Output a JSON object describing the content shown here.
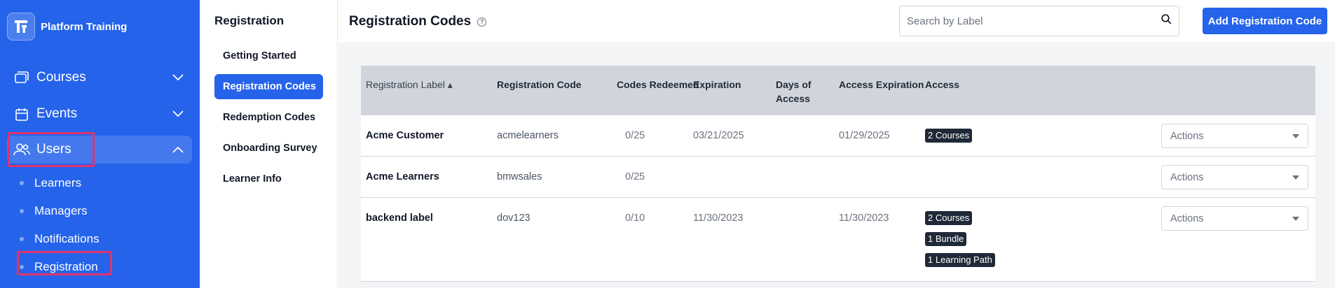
{
  "app": {
    "name": "Platform Training"
  },
  "sidebar": {
    "items": [
      {
        "label": "Courses",
        "icon": "courses-icon"
      },
      {
        "label": "Events",
        "icon": "calendar-icon"
      },
      {
        "label": "Users",
        "icon": "users-icon",
        "expanded": true
      }
    ],
    "subitems": [
      "Learners",
      "Managers",
      "Notifications",
      "Registration"
    ]
  },
  "secondary_menu": {
    "title": "Registration",
    "items": [
      "Getting Started",
      "Registration Codes",
      "Redemption Codes",
      "Onboarding Survey",
      "Learner Info"
    ],
    "active": "Registration Codes"
  },
  "header": {
    "title": "Registration Codes",
    "help_glyph": "?",
    "search_placeholder": "Search by Label",
    "add_button": "Add Registration Code"
  },
  "table": {
    "columns": [
      "Registration Label ▴",
      "Registration Code",
      "Codes Redeemed",
      "Expiration",
      "Days of Access",
      "Access Expiration",
      "Access"
    ],
    "rows": [
      {
        "label": "Acme Customer",
        "code": "acmelearners",
        "redeemed": "0/25",
        "expiration": "03/21/2025",
        "days": "",
        "access_expiration": "01/29/2025",
        "access": [
          "2 Courses"
        ],
        "action": "Actions"
      },
      {
        "label": "Acme Learners",
        "code": "bmwsales",
        "redeemed": "0/25",
        "expiration": "",
        "days": "",
        "access_expiration": "",
        "access": [],
        "action": "Actions"
      },
      {
        "label": "backend label",
        "code": "dov123",
        "redeemed": "0/10",
        "expiration": "11/30/2023",
        "days": "",
        "access_expiration": "11/30/2023",
        "access": [
          "2 Courses",
          "1 Bundle",
          "1 Learning Path"
        ],
        "action": "Actions"
      }
    ]
  },
  "colors": {
    "primary": "#2563eb",
    "highlight": "#e0336c",
    "header_bg": "#d1d5db",
    "badge_bg": "#1f2937"
  }
}
